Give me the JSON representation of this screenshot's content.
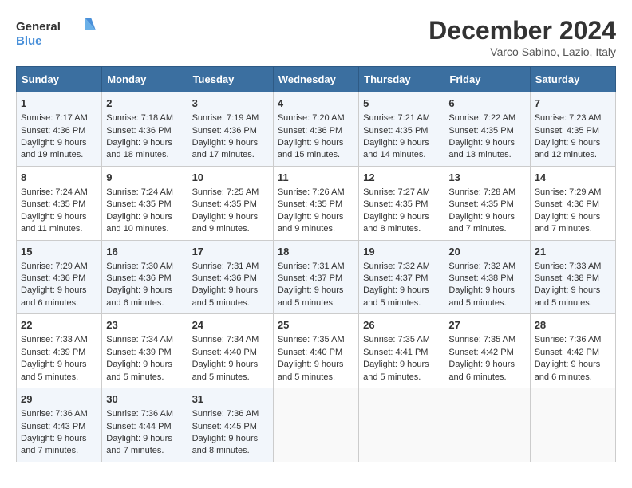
{
  "logo": {
    "line1": "General",
    "line2": "Blue"
  },
  "title": "December 2024",
  "subtitle": "Varco Sabino, Lazio, Italy",
  "days_of_week": [
    "Sunday",
    "Monday",
    "Tuesday",
    "Wednesday",
    "Thursday",
    "Friday",
    "Saturday"
  ],
  "weeks": [
    [
      {
        "day": "1",
        "sunrise": "7:17 AM",
        "sunset": "4:36 PM",
        "daylight": "9 hours and 19 minutes."
      },
      {
        "day": "2",
        "sunrise": "7:18 AM",
        "sunset": "4:36 PM",
        "daylight": "9 hours and 18 minutes."
      },
      {
        "day": "3",
        "sunrise": "7:19 AM",
        "sunset": "4:36 PM",
        "daylight": "9 hours and 17 minutes."
      },
      {
        "day": "4",
        "sunrise": "7:20 AM",
        "sunset": "4:36 PM",
        "daylight": "9 hours and 15 minutes."
      },
      {
        "day": "5",
        "sunrise": "7:21 AM",
        "sunset": "4:35 PM",
        "daylight": "9 hours and 14 minutes."
      },
      {
        "day": "6",
        "sunrise": "7:22 AM",
        "sunset": "4:35 PM",
        "daylight": "9 hours and 13 minutes."
      },
      {
        "day": "7",
        "sunrise": "7:23 AM",
        "sunset": "4:35 PM",
        "daylight": "9 hours and 12 minutes."
      }
    ],
    [
      {
        "day": "8",
        "sunrise": "7:24 AM",
        "sunset": "4:35 PM",
        "daylight": "9 hours and 11 minutes."
      },
      {
        "day": "9",
        "sunrise": "7:24 AM",
        "sunset": "4:35 PM",
        "daylight": "9 hours and 10 minutes."
      },
      {
        "day": "10",
        "sunrise": "7:25 AM",
        "sunset": "4:35 PM",
        "daylight": "9 hours and 9 minutes."
      },
      {
        "day": "11",
        "sunrise": "7:26 AM",
        "sunset": "4:35 PM",
        "daylight": "9 hours and 9 minutes."
      },
      {
        "day": "12",
        "sunrise": "7:27 AM",
        "sunset": "4:35 PM",
        "daylight": "9 hours and 8 minutes."
      },
      {
        "day": "13",
        "sunrise": "7:28 AM",
        "sunset": "4:35 PM",
        "daylight": "9 hours and 7 minutes."
      },
      {
        "day": "14",
        "sunrise": "7:29 AM",
        "sunset": "4:36 PM",
        "daylight": "9 hours and 7 minutes."
      }
    ],
    [
      {
        "day": "15",
        "sunrise": "7:29 AM",
        "sunset": "4:36 PM",
        "daylight": "9 hours and 6 minutes."
      },
      {
        "day": "16",
        "sunrise": "7:30 AM",
        "sunset": "4:36 PM",
        "daylight": "9 hours and 6 minutes."
      },
      {
        "day": "17",
        "sunrise": "7:31 AM",
        "sunset": "4:36 PM",
        "daylight": "9 hours and 5 minutes."
      },
      {
        "day": "18",
        "sunrise": "7:31 AM",
        "sunset": "4:37 PM",
        "daylight": "9 hours and 5 minutes."
      },
      {
        "day": "19",
        "sunrise": "7:32 AM",
        "sunset": "4:37 PM",
        "daylight": "9 hours and 5 minutes."
      },
      {
        "day": "20",
        "sunrise": "7:32 AM",
        "sunset": "4:38 PM",
        "daylight": "9 hours and 5 minutes."
      },
      {
        "day": "21",
        "sunrise": "7:33 AM",
        "sunset": "4:38 PM",
        "daylight": "9 hours and 5 minutes."
      }
    ],
    [
      {
        "day": "22",
        "sunrise": "7:33 AM",
        "sunset": "4:39 PM",
        "daylight": "9 hours and 5 minutes."
      },
      {
        "day": "23",
        "sunrise": "7:34 AM",
        "sunset": "4:39 PM",
        "daylight": "9 hours and 5 minutes."
      },
      {
        "day": "24",
        "sunrise": "7:34 AM",
        "sunset": "4:40 PM",
        "daylight": "9 hours and 5 minutes."
      },
      {
        "day": "25",
        "sunrise": "7:35 AM",
        "sunset": "4:40 PM",
        "daylight": "9 hours and 5 minutes."
      },
      {
        "day": "26",
        "sunrise": "7:35 AM",
        "sunset": "4:41 PM",
        "daylight": "9 hours and 5 minutes."
      },
      {
        "day": "27",
        "sunrise": "7:35 AM",
        "sunset": "4:42 PM",
        "daylight": "9 hours and 6 minutes."
      },
      {
        "day": "28",
        "sunrise": "7:36 AM",
        "sunset": "4:42 PM",
        "daylight": "9 hours and 6 minutes."
      }
    ],
    [
      {
        "day": "29",
        "sunrise": "7:36 AM",
        "sunset": "4:43 PM",
        "daylight": "9 hours and 7 minutes."
      },
      {
        "day": "30",
        "sunrise": "7:36 AM",
        "sunset": "4:44 PM",
        "daylight": "9 hours and 7 minutes."
      },
      {
        "day": "31",
        "sunrise": "7:36 AM",
        "sunset": "4:45 PM",
        "daylight": "9 hours and 8 minutes."
      },
      null,
      null,
      null,
      null
    ]
  ]
}
